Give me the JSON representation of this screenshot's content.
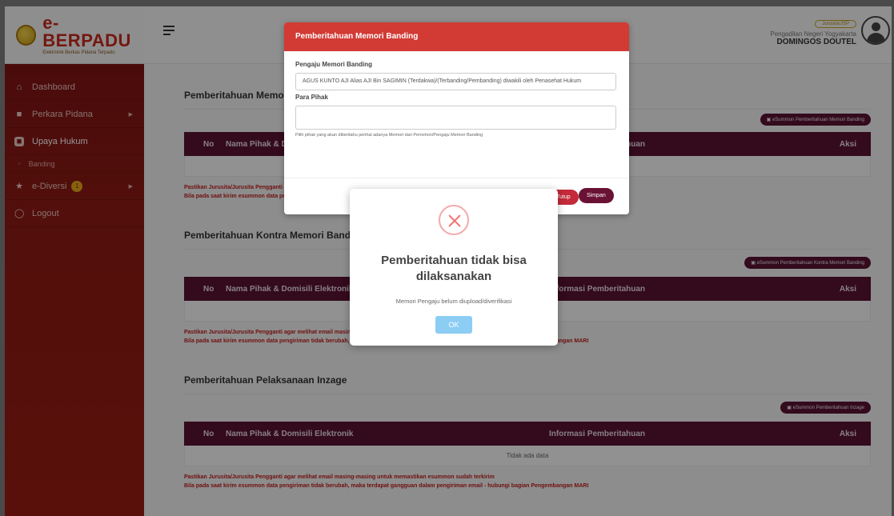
{
  "brand": {
    "name_main": "e-BER",
    "name_accent": "PADU",
    "subtitle": "Elektronik Berkas Pidana Terpadu"
  },
  "sidebar": {
    "items": [
      {
        "label": "Dashboard"
      },
      {
        "label": "Perkara Pidana"
      },
      {
        "label": "Upaya Hukum"
      },
      {
        "label": "Banding"
      },
      {
        "label": "e-Diversi",
        "badge": "1"
      },
      {
        "label": "Logout"
      }
    ]
  },
  "user": {
    "role": "Jurusita/JSP",
    "court": "Pengadilan Negeri Yogyakarta",
    "name": "DOMINGOS DOUTEL"
  },
  "sections": [
    {
      "title": "Pemberitahuan Memori",
      "summon_btn": "eSummon Pemberitahuan Memori Banding"
    },
    {
      "title": "Pemberitahuan Kontra Memori Banding",
      "summon_btn": "eSummon Pemberitahuan Kontra Memori Banding"
    },
    {
      "title": "Pemberitahuan Pelaksanaan Inzage",
      "summon_btn": "eSummon Pemberitahuan Inzage",
      "empty_text": "Tidak ada data"
    }
  ],
  "table_headers": {
    "no": "No",
    "nama": "Nama Pihak & Domisili Elektronik",
    "info": "Informasi Pemberitahuan",
    "aksi": "Aksi"
  },
  "warnings": {
    "line1": "Pastikan Jurusita/Jurusita Pengganti agar melihat email masing-masing untuk memastikan esummon sudah terkirim",
    "line2": "Bila pada saat kirim esummon data pengiriman tidak berubah, maka terdapat gangguan dalam pengiriman email - hubungi bagian Pengembangan MARI"
  },
  "modal": {
    "title": "Pemberitahuan Memori Banding",
    "field1_label": "Pengaju Memori Banding",
    "field1_value": "AGUS KUNTO AJI Alias AJI Bin SAGIMIN (Terdakwa)/(Terbanding/Pembanding) diwakili oleh Penasehat Hukum",
    "field2_label": "Para Pihak",
    "field2_hint": "Pilih pihak yang akan diberitahu perihal adanya Memori dari Pemohon/Pengaju Memori Banding",
    "btn_close": "Tutup",
    "btn_save": "Simpan"
  },
  "alert": {
    "title": "Pemberitahuan tidak bisa dilaksanakan",
    "text": "Memori Pengaju belum diupload/diverifikasi",
    "ok": "OK"
  }
}
